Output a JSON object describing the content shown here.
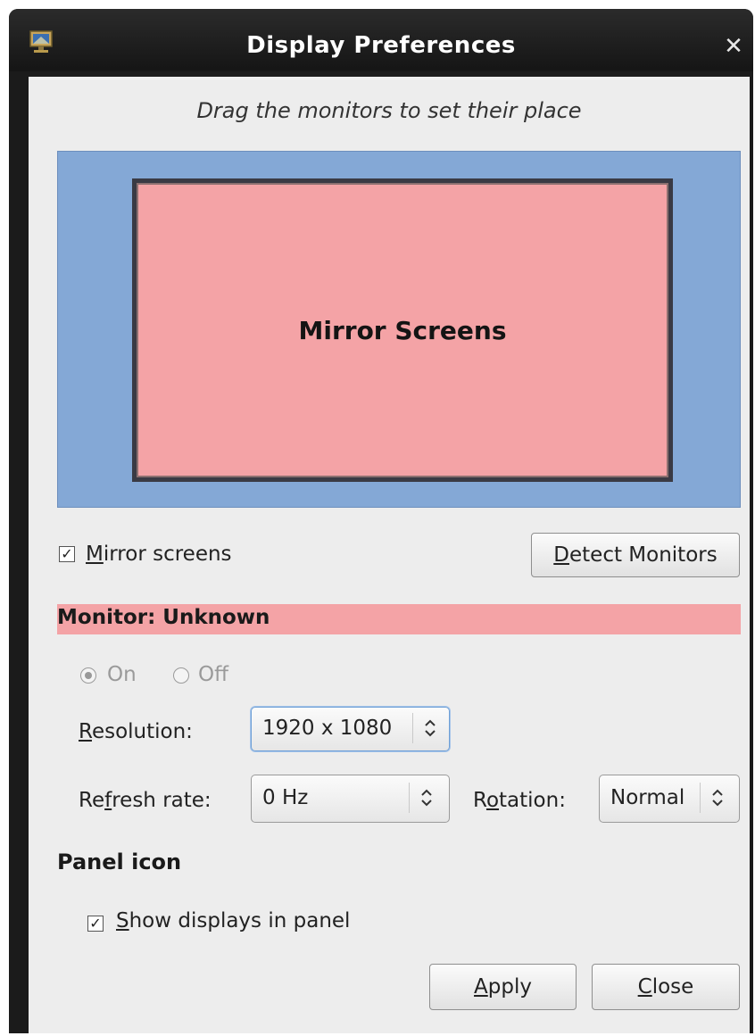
{
  "window": {
    "title": "Display Preferences",
    "app_icon": "display-preferences-icon",
    "close_icon": "close-icon"
  },
  "instructions": "Drag the monitors to set their place",
  "monitor_area": {
    "monitor_label": "Mirror Screens"
  },
  "mirror_screens": {
    "label_mnemonic": "M",
    "label_rest": "irror screens",
    "checked": true
  },
  "detect_monitors": {
    "label_mnemonic": "D",
    "label_rest": "etect Monitors"
  },
  "monitor_section": {
    "title": "Monitor: Unknown"
  },
  "power": {
    "on_label": "On",
    "off_label": "Off",
    "selected": "On",
    "enabled": false
  },
  "resolution": {
    "label_mnemonic": "R",
    "label_rest": "esolution:",
    "value": "1920 x 1080"
  },
  "refresh_rate": {
    "label_pre": "Re",
    "label_mnemonic": "f",
    "label_rest": "resh rate:",
    "value": "0 Hz"
  },
  "rotation": {
    "label_pre": "R",
    "label_mnemonic": "o",
    "label_rest": "tation:",
    "value": "Normal"
  },
  "panel_icon": {
    "title": "Panel icon",
    "show_label_mnemonic": "S",
    "show_label_rest": "how displays in panel",
    "checked": true
  },
  "buttons": {
    "apply_mnemonic": "A",
    "apply_rest": "pply",
    "close_mnemonic": "C",
    "close_rest": "lose"
  },
  "colors": {
    "monitor_fill": "#f4a3a6",
    "layout_background": "#84a8d6",
    "dialog_background": "#ededed",
    "titlebar": "#1b1b1b"
  }
}
